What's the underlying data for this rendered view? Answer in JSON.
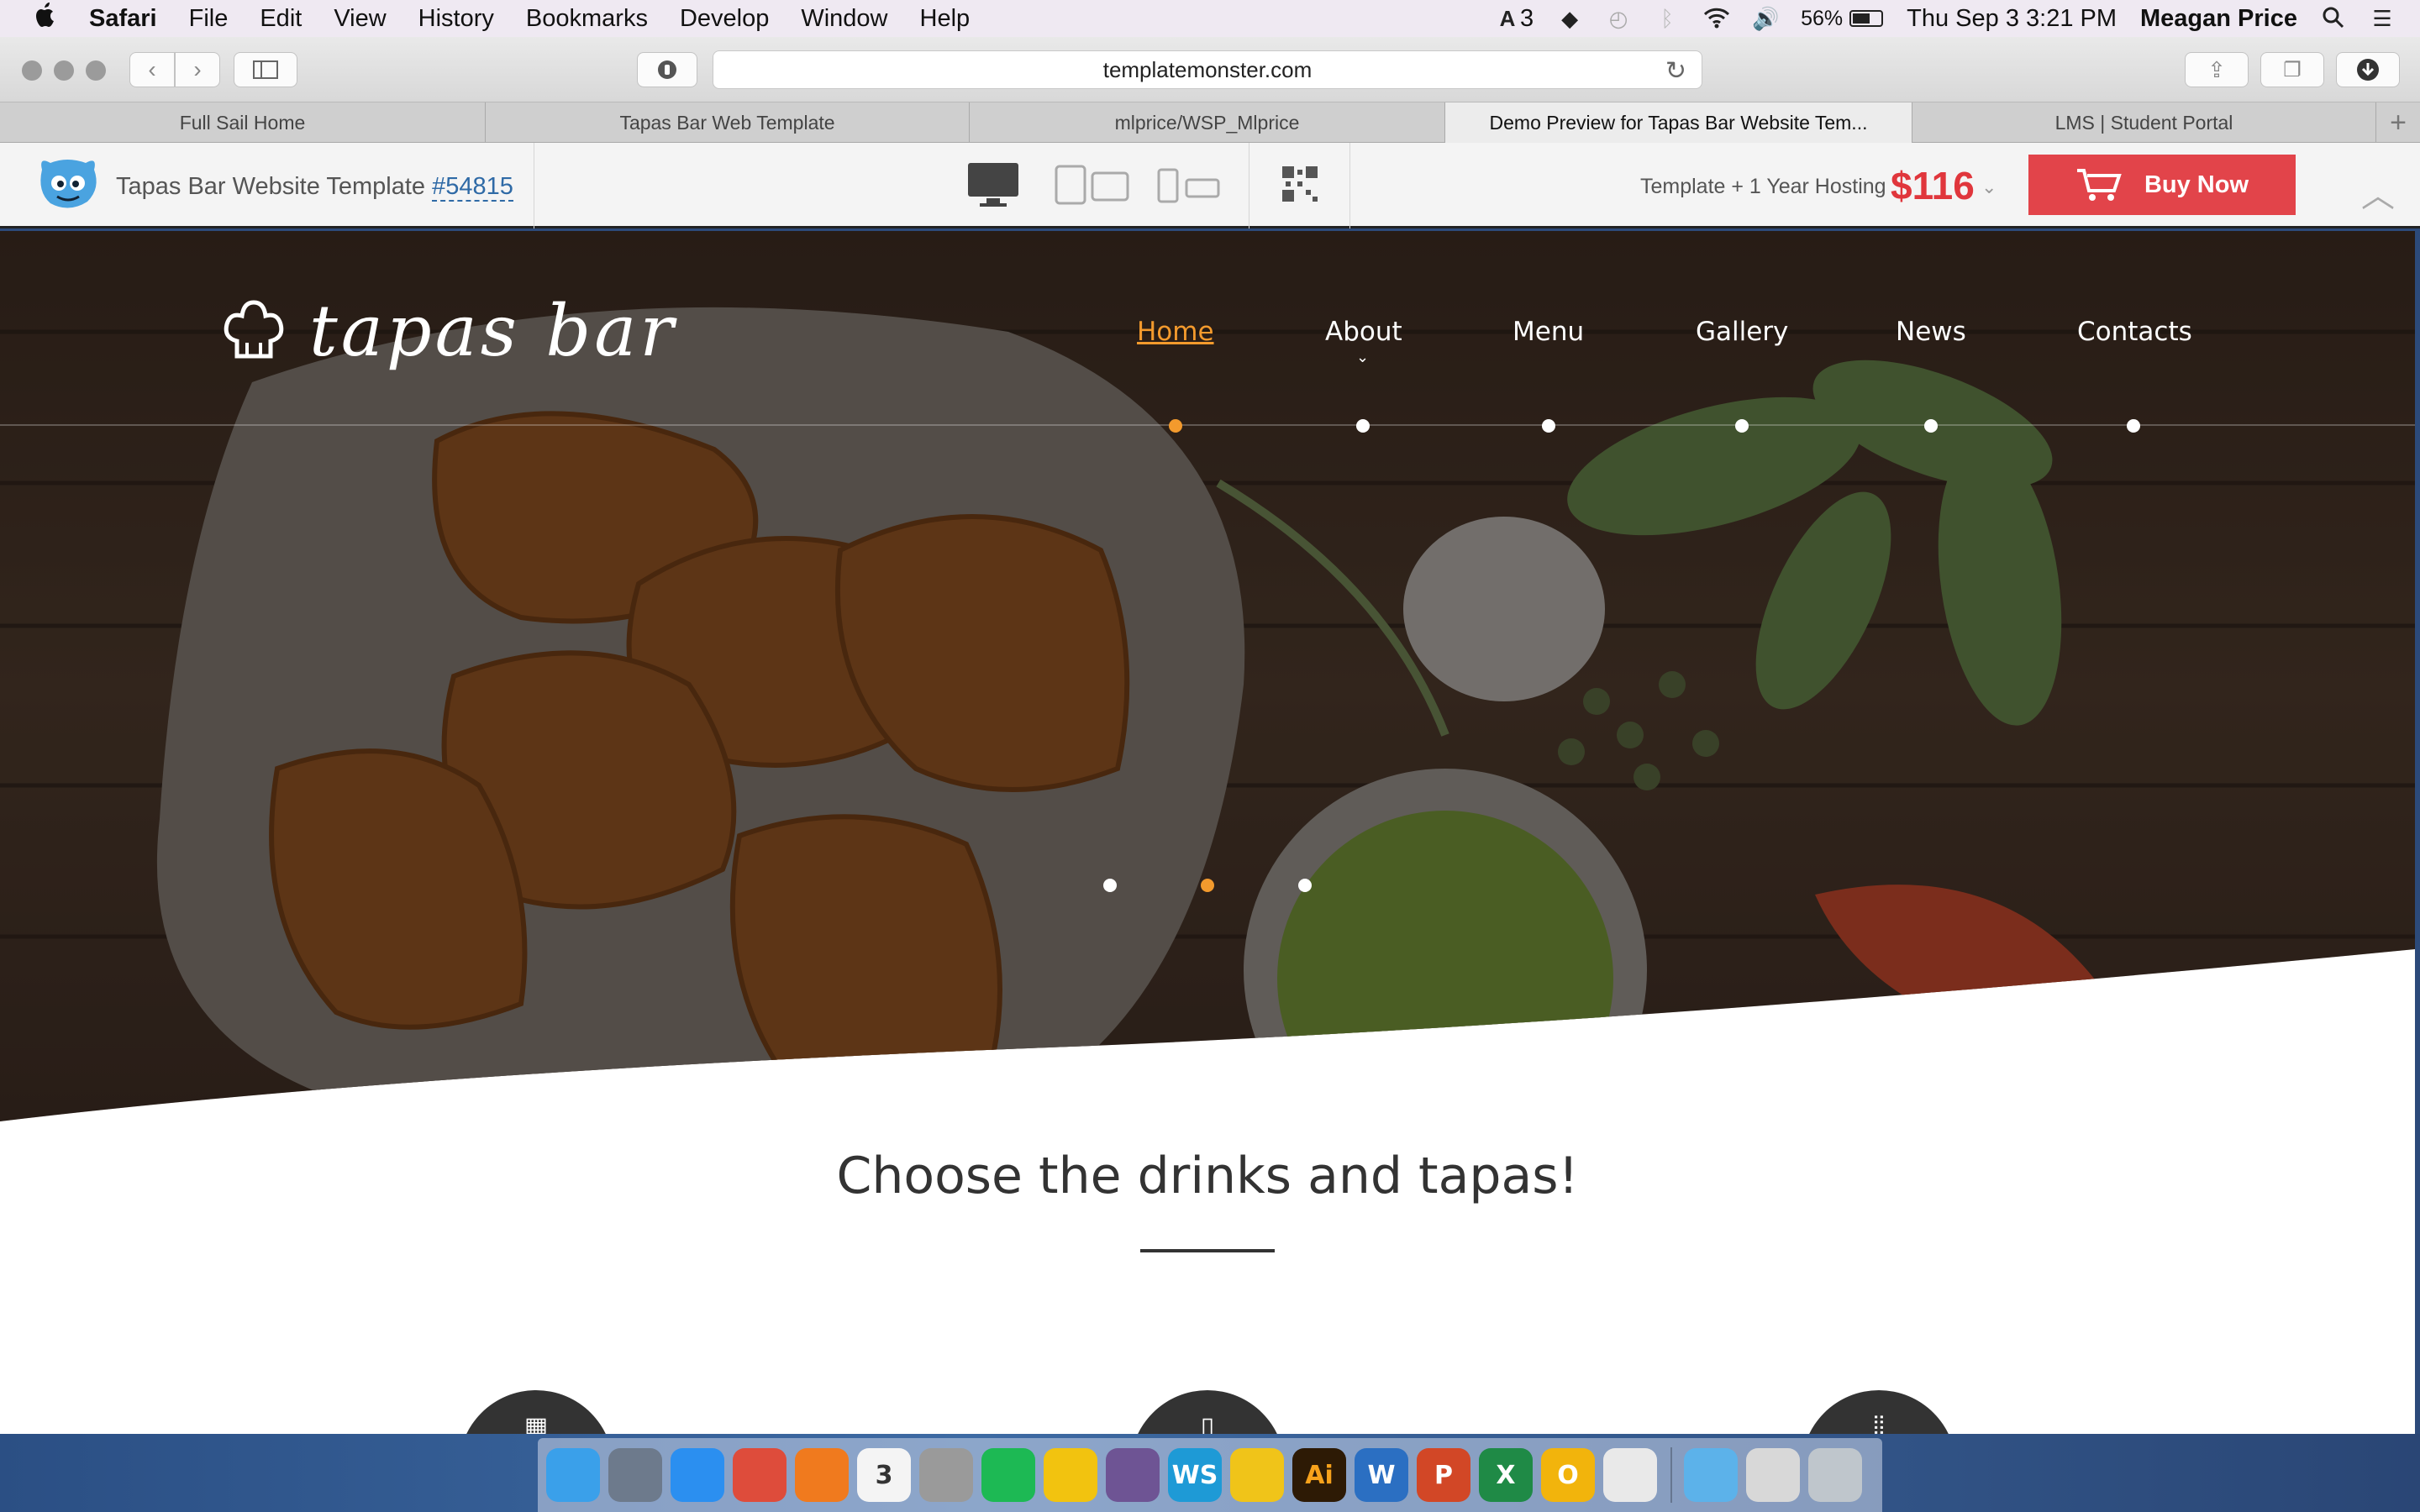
{
  "menubar": {
    "app_name": "Safari",
    "items": [
      "File",
      "Edit",
      "View",
      "History",
      "Bookmarks",
      "Develop",
      "Window",
      "Help"
    ],
    "adobe_count": "3",
    "battery": "56%",
    "datetime": "Thu Sep 3  3:21 PM",
    "user": "Meagan Price"
  },
  "browser": {
    "url": "templatemonster.com",
    "tabs": [
      "Full Sail Home",
      "Tapas Bar Web Template",
      "mlprice/WSP_Mlprice",
      "Demo Preview for Tapas Bar Website Tem...",
      "LMS | Student Portal"
    ],
    "active_tab_index": 3
  },
  "preview_bar": {
    "title": "Tapas Bar Website Template ",
    "template_id": "#54815",
    "offer_label": "Template + 1 Year Hosting",
    "price": "$116",
    "buy_label": "Buy Now"
  },
  "site": {
    "brand": "tapas bar",
    "nav": [
      "Home",
      "About",
      "Menu",
      "Gallery",
      "News",
      "Contacts"
    ],
    "active_nav_index": 0,
    "slider_count": 3,
    "active_slide": 1,
    "section_title": "Choose the drinks and tapas!"
  },
  "colors": {
    "accent_orange": "#f39a2d",
    "buy_red": "#e2444a",
    "price_red": "#e0363c",
    "link_blue": "#2f6aa6"
  },
  "dock": {
    "apps": [
      {
        "name": "Finder",
        "glyph": "",
        "color": "#3aa0ea"
      },
      {
        "name": "Launchpad",
        "glyph": "",
        "color": "#6d7a8c"
      },
      {
        "name": "Safari",
        "glyph": "",
        "color": "#2b8ff0"
      },
      {
        "name": "Chrome",
        "glyph": "",
        "color": "#de4c3b"
      },
      {
        "name": "Firefox",
        "glyph": "",
        "color": "#f07a1e"
      },
      {
        "name": "Calendar",
        "glyph": "3",
        "color": "#f4f4f4"
      },
      {
        "name": "Calculator",
        "glyph": "",
        "color": "#9a9a9a"
      },
      {
        "name": "Spotify",
        "glyph": "",
        "color": "#1db954"
      },
      {
        "name": "AIM",
        "glyph": "",
        "color": "#f2c30f"
      },
      {
        "name": "GitHub",
        "glyph": "",
        "color": "#6e5494"
      },
      {
        "name": "WebStorm",
        "glyph": "WS",
        "color": "#1e9ad6"
      },
      {
        "name": "Wunderlist",
        "glyph": "",
        "color": "#f0c419"
      },
      {
        "name": "Illustrator",
        "glyph": "Ai",
        "color": "#2d1a05"
      },
      {
        "name": "Word",
        "glyph": "W",
        "color": "#2b6fc2"
      },
      {
        "name": "PowerPoint",
        "glyph": "P",
        "color": "#d24726"
      },
      {
        "name": "Excel",
        "glyph": "X",
        "color": "#1f8a46"
      },
      {
        "name": "Outlook",
        "glyph": "O",
        "color": "#f2b40c"
      },
      {
        "name": "Photos",
        "glyph": "",
        "color": "#e9e9e9"
      }
    ],
    "stack_apps": [
      {
        "name": "Downloads",
        "glyph": "",
        "color": "#5cb2ea"
      },
      {
        "name": "Screenshots",
        "glyph": "",
        "color": "#d8d8d8"
      },
      {
        "name": "Trash",
        "glyph": "",
        "color": "#bfc6cc"
      }
    ]
  }
}
